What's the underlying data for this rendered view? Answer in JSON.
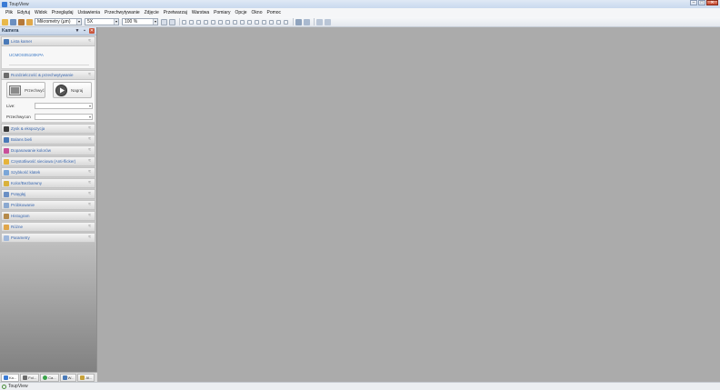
{
  "window": {
    "title": "ToupView",
    "buttons": {
      "minimize": "–",
      "maximize": "□",
      "close": "✕"
    }
  },
  "menubar": {
    "items": [
      "Plik",
      "Edytuj",
      "Widok",
      "Przeglądaj",
      "Ustawienia",
      "Przechwytywanie",
      "Zdjęcie",
      "Przetwarzaj",
      "Warstwa",
      "Pomiary",
      "Opcje",
      "Okno",
      "Pomoc"
    ]
  },
  "toolbar": {
    "unit_select": "Mikrometry (µm)",
    "magnification_select": "5X",
    "zoom_select": "100 %"
  },
  "panel": {
    "title": "Kamera",
    "pin_icon": "▼",
    "dock_icon": "▪",
    "close_icon": "✕",
    "sections": {
      "camera_list": {
        "label": "Lista kamer",
        "device": "UCMOS05100KPA"
      },
      "resolution": {
        "label": "Rozdzielczość & przechwytywanie",
        "snap_label": "Przechwyć",
        "record_label": "Nagraj",
        "live_label": "Live:",
        "capture_label": "Przechwycon"
      },
      "collapsed": [
        {
          "key": "exposure",
          "label": "Zysk & ekspozycja",
          "icon_color": "#3b3b3b"
        },
        {
          "key": "white_balance",
          "label": "Balans bieli",
          "icon_color": "#4a7ab8"
        },
        {
          "key": "color_adjust",
          "label": "Dopasowanie kolorów",
          "icon_color": "#c84f9a"
        },
        {
          "key": "flicker",
          "label": "Częstotliwość sieciowa (Anti-flicker)",
          "icon_color": "#e5b33a"
        },
        {
          "key": "frame_speed",
          "label": "Szybkość klatek",
          "icon_color": "#7aa6d8"
        },
        {
          "key": "color_mono",
          "label": "Kolor/Bezbarwny",
          "icon_color": "#d9b13b"
        },
        {
          "key": "bit_depth",
          "label": "Potęgłęj",
          "icon_color": "#6a8fc4"
        },
        {
          "key": "sampling",
          "label": "Próbkowanie",
          "icon_color": "#8aa8d0"
        },
        {
          "key": "histogram",
          "label": "Histogram",
          "icon_color": "#b58a4a"
        },
        {
          "key": "other",
          "label": "Różne",
          "icon_color": "#e0a64a"
        },
        {
          "key": "parameters",
          "label": "Parametry",
          "icon_color": "#9fb8dc"
        }
      ]
    },
    "collapse_glyph": "≈"
  },
  "bottom_tabs": [
    {
      "label": "Ka...",
      "icon_color": "#3a7bd5"
    },
    {
      "label": "Fol...",
      "icon_color": "#6b6b6b"
    },
    {
      "label": "Ca...",
      "icon_color": "#3aa34a"
    },
    {
      "label": "W...",
      "icon_color": "#4a7ab8"
    },
    {
      "label": "Al...",
      "icon_color": "#c7a23a"
    }
  ],
  "status": {
    "text": "ToupView"
  },
  "colors": {
    "workspace": "#ababab",
    "section_label": "#3a68b0",
    "link": "#3a78c4"
  }
}
